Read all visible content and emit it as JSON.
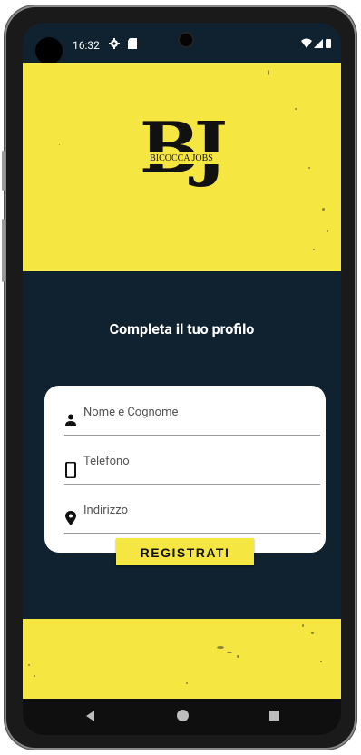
{
  "status_bar": {
    "time": "16:32",
    "settings_icon": "gear-icon",
    "sim_icon": "sd-card-icon",
    "wifi_icon": "wifi-icon",
    "signal_icon": "signal-icon",
    "battery_icon": "battery-icon"
  },
  "logo": {
    "monogram": "BJ",
    "name": "BICOCCA JOBS"
  },
  "page": {
    "title": "Completa il tuo profilo"
  },
  "form": {
    "name_placeholder": "Nome e Cognome",
    "phone_placeholder": "Telefono",
    "address_placeholder": "Indirizzo",
    "submit_label": "REGISTRATI"
  },
  "colors": {
    "brand_yellow": "#f5e642",
    "background_dark": "#10222f"
  },
  "navbar": {
    "back_icon": "back-triangle-icon",
    "home_icon": "home-circle-icon",
    "recents_icon": "recents-square-icon"
  }
}
